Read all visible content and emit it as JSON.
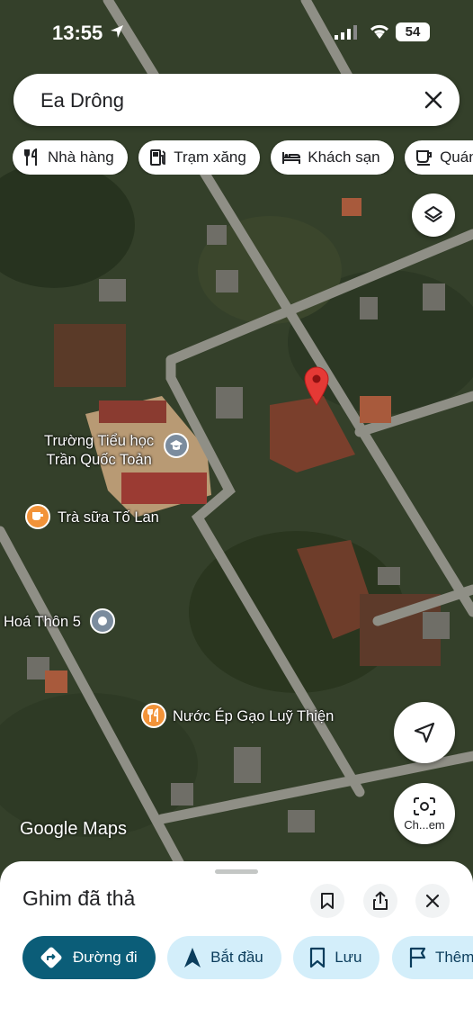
{
  "status": {
    "time": "13:55",
    "battery": "54"
  },
  "search": {
    "query": "Ea Drông"
  },
  "chips": [
    {
      "label": "Nhà hàng",
      "icon": "restaurant-icon"
    },
    {
      "label": "Trạm xăng",
      "icon": "gas-station-icon"
    },
    {
      "label": "Khách sạn",
      "icon": "hotel-icon"
    },
    {
      "label": "Quán",
      "icon": "cafe-icon"
    }
  ],
  "map": {
    "labels": {
      "school": "Trường Tiểu học\nTrần Quốc Toản",
      "tea": "Trà sữa Tố Lan",
      "village": "Hoá Thôn 5",
      "juice": "Nước Ép Gạo Luỹ Thiện"
    },
    "logo": "Google Maps",
    "lens_label": "Ch...em"
  },
  "sheet": {
    "title": "Ghim đã thả",
    "actions": [
      {
        "label": "Đường đi"
      },
      {
        "label": "Bắt đầu"
      },
      {
        "label": "Lưu"
      },
      {
        "label": "Thêm"
      }
    ]
  },
  "colors": {
    "accent": "#0b5d78",
    "pin": "#e53935",
    "poi_orange": "#f29339"
  }
}
